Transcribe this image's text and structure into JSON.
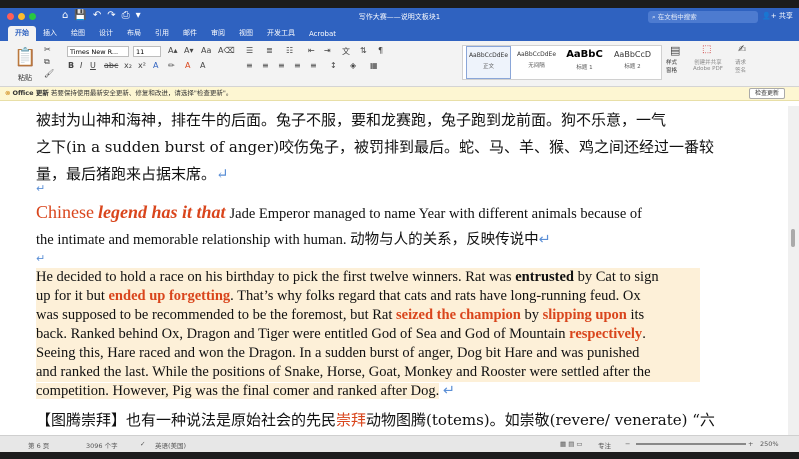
{
  "titlebar": {
    "doc_title": "写作大赛——说明文板块1",
    "search_placeholder": "在文档中搜索",
    "share_label": "共享",
    "quick_access": [
      "⌂",
      "💾",
      "↶",
      "↷",
      "⎙",
      "▾"
    ]
  },
  "tabs": [
    "开始",
    "插入",
    "绘图",
    "设计",
    "布局",
    "引用",
    "邮件",
    "审阅",
    "视图",
    "开发工具",
    "Acrobat"
  ],
  "ribbon": {
    "paste_label": "粘贴",
    "font_name": "Times New R...",
    "font_size": "11",
    "styles": [
      {
        "preview": "AaBbCcDdEe",
        "label": "正文"
      },
      {
        "preview": "AaBbCcDdEe",
        "label": "无间隔"
      },
      {
        "preview": "AaBbC",
        "label": "标题 1"
      },
      {
        "preview": "AaBbCcD",
        "label": "标题 2"
      }
    ],
    "styles_pane_label": "样式\n窗格",
    "adobe_pdf_label": "创建并共享\nAdobe PDF",
    "request_sign_label": "请求\n签名"
  },
  "notice": {
    "title": "Office 更新",
    "text": "若要保持使用最新安全更新、修复和改进，请选择\"检查更新\"。",
    "button": "检查更新"
  },
  "document": {
    "zh_line1": "被封为山神和海神，排在牛的后面。兔子不服，要和龙赛跑，兔子跑到龙前面。狗不乐意，一气",
    "zh_line2": "之下(in a sudden burst of anger)咬伤兔子，被罚排到最后。蛇、马、羊、猴、鸡之间还经过一番较",
    "zh_line3": "量，最后猪跑来占据末席。",
    "heading_chinese": "Chinese",
    "heading_phrase": "legend has it that",
    "heading_rest": "Jade Emperor managed to name Year with different animals because of",
    "heading_line2": "the intimate and memorable relationship with human. 动物与人的关系，反映传说中",
    "para": [
      [
        "He decided to hold a race on his birthday to pick the first twelve winners. Rat was ",
        "entrusted",
        " by Cat to sign"
      ],
      [
        "up for it but ",
        "ended up forgetting",
        ". That’s why folks regard that cats and rats have long-running feud. Ox"
      ],
      [
        "was supposed to be recommended to be the foremost, but Rat ",
        "seized the champion",
        " by ",
        "slipping upon",
        " its"
      ],
      [
        "back. Ranked behind Ox, Dragon and Tiger were entitled God of Sea and God of Mountain ",
        "respectively",
        "."
      ],
      [
        "Seeing this, Hare raced and won the Dragon. In a sudden burst of anger, Dog bit Hare and was punished"
      ],
      [
        "and ranked the last. While the positions of Snake, Horse, Goat, Monkey and Rooster were settled after the"
      ],
      [
        "competition. However, Pig was the final comer and ranked after Dog."
      ]
    ],
    "last_line_a": "【图腾崇拜】也有一种说法是原始社会的先民",
    "last_line_red": "崇拜",
    "last_line_b": "动物图腾(totems)。如崇敬(revere/  venerate) “六"
  },
  "statusbar": {
    "page": "第 6 页",
    "words": "3096 个字",
    "lang": "英语(美国)",
    "focus": "专注",
    "zoom": "250%"
  },
  "colors": {
    "ribbon_blue": "#2f62c0",
    "accent_red": "#d9451c",
    "highlight": "#fdf0d8"
  }
}
